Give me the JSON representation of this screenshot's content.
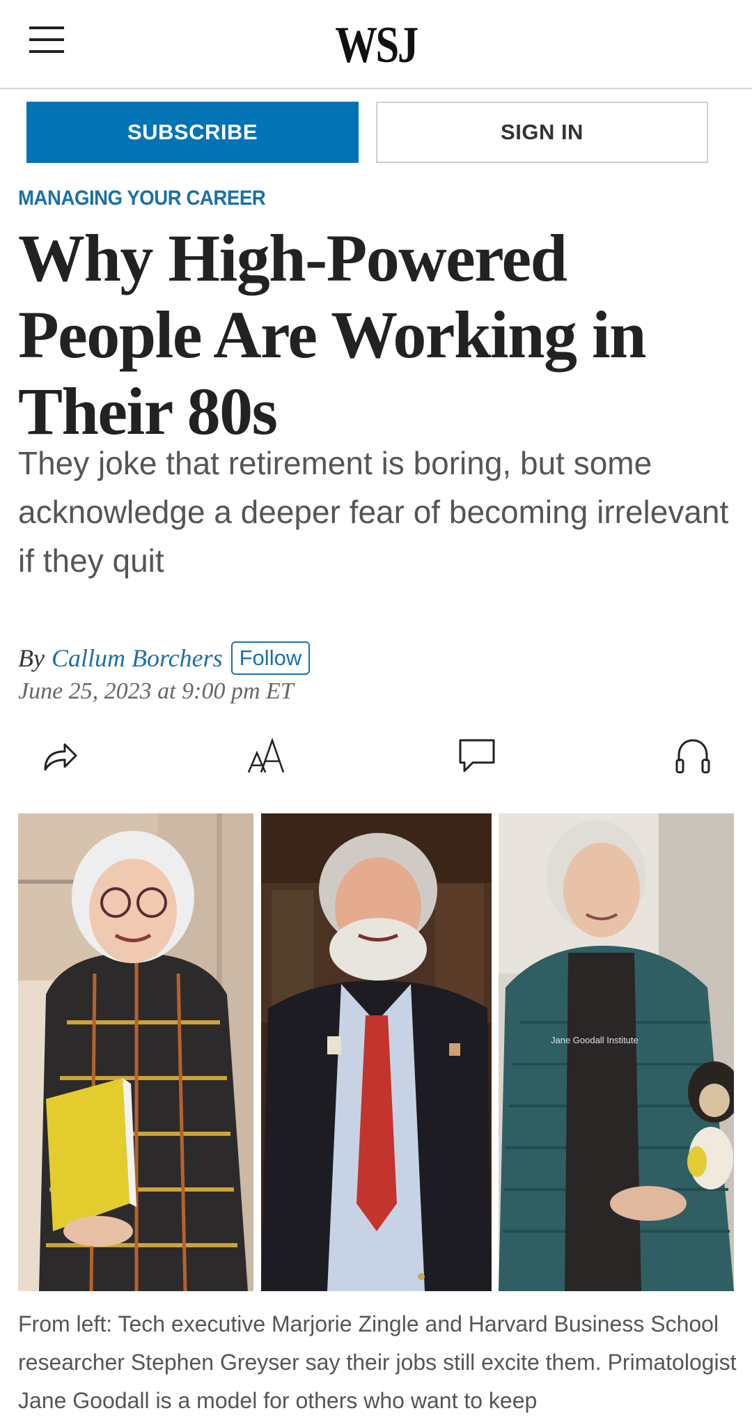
{
  "header": {
    "logo": "WSJ"
  },
  "auth": {
    "subscribe_label": "SUBSCRIBE",
    "signin_label": "SIGN IN"
  },
  "article": {
    "section": "MANAGING YOUR CAREER",
    "headline": "Why High-Powered People Are Working in Their 80s",
    "dek": "They joke that retirement is boring, but some acknowledge a deeper fear of becoming irrelevant if they quit",
    "byline_prefix": "By",
    "author": "Callum Borchers",
    "follow_label": "Follow",
    "date": "June 25, 2023 at 9:00 pm ET",
    "caption": "From left: Tech executive Marjorie Zingle and Harvard Business School researcher Stephen Greyser say their jobs still excite them. Primatologist Jane Goodall is a model for others who want to keep"
  },
  "tools": [
    "share-icon",
    "text-size-icon",
    "comment-icon",
    "listen-icon"
  ],
  "colors": {
    "accent_blue": "#0274b6",
    "link_blue": "#1b6fa8"
  },
  "photo_text": {
    "jacket_logo": "Jane Goodall Institute"
  }
}
